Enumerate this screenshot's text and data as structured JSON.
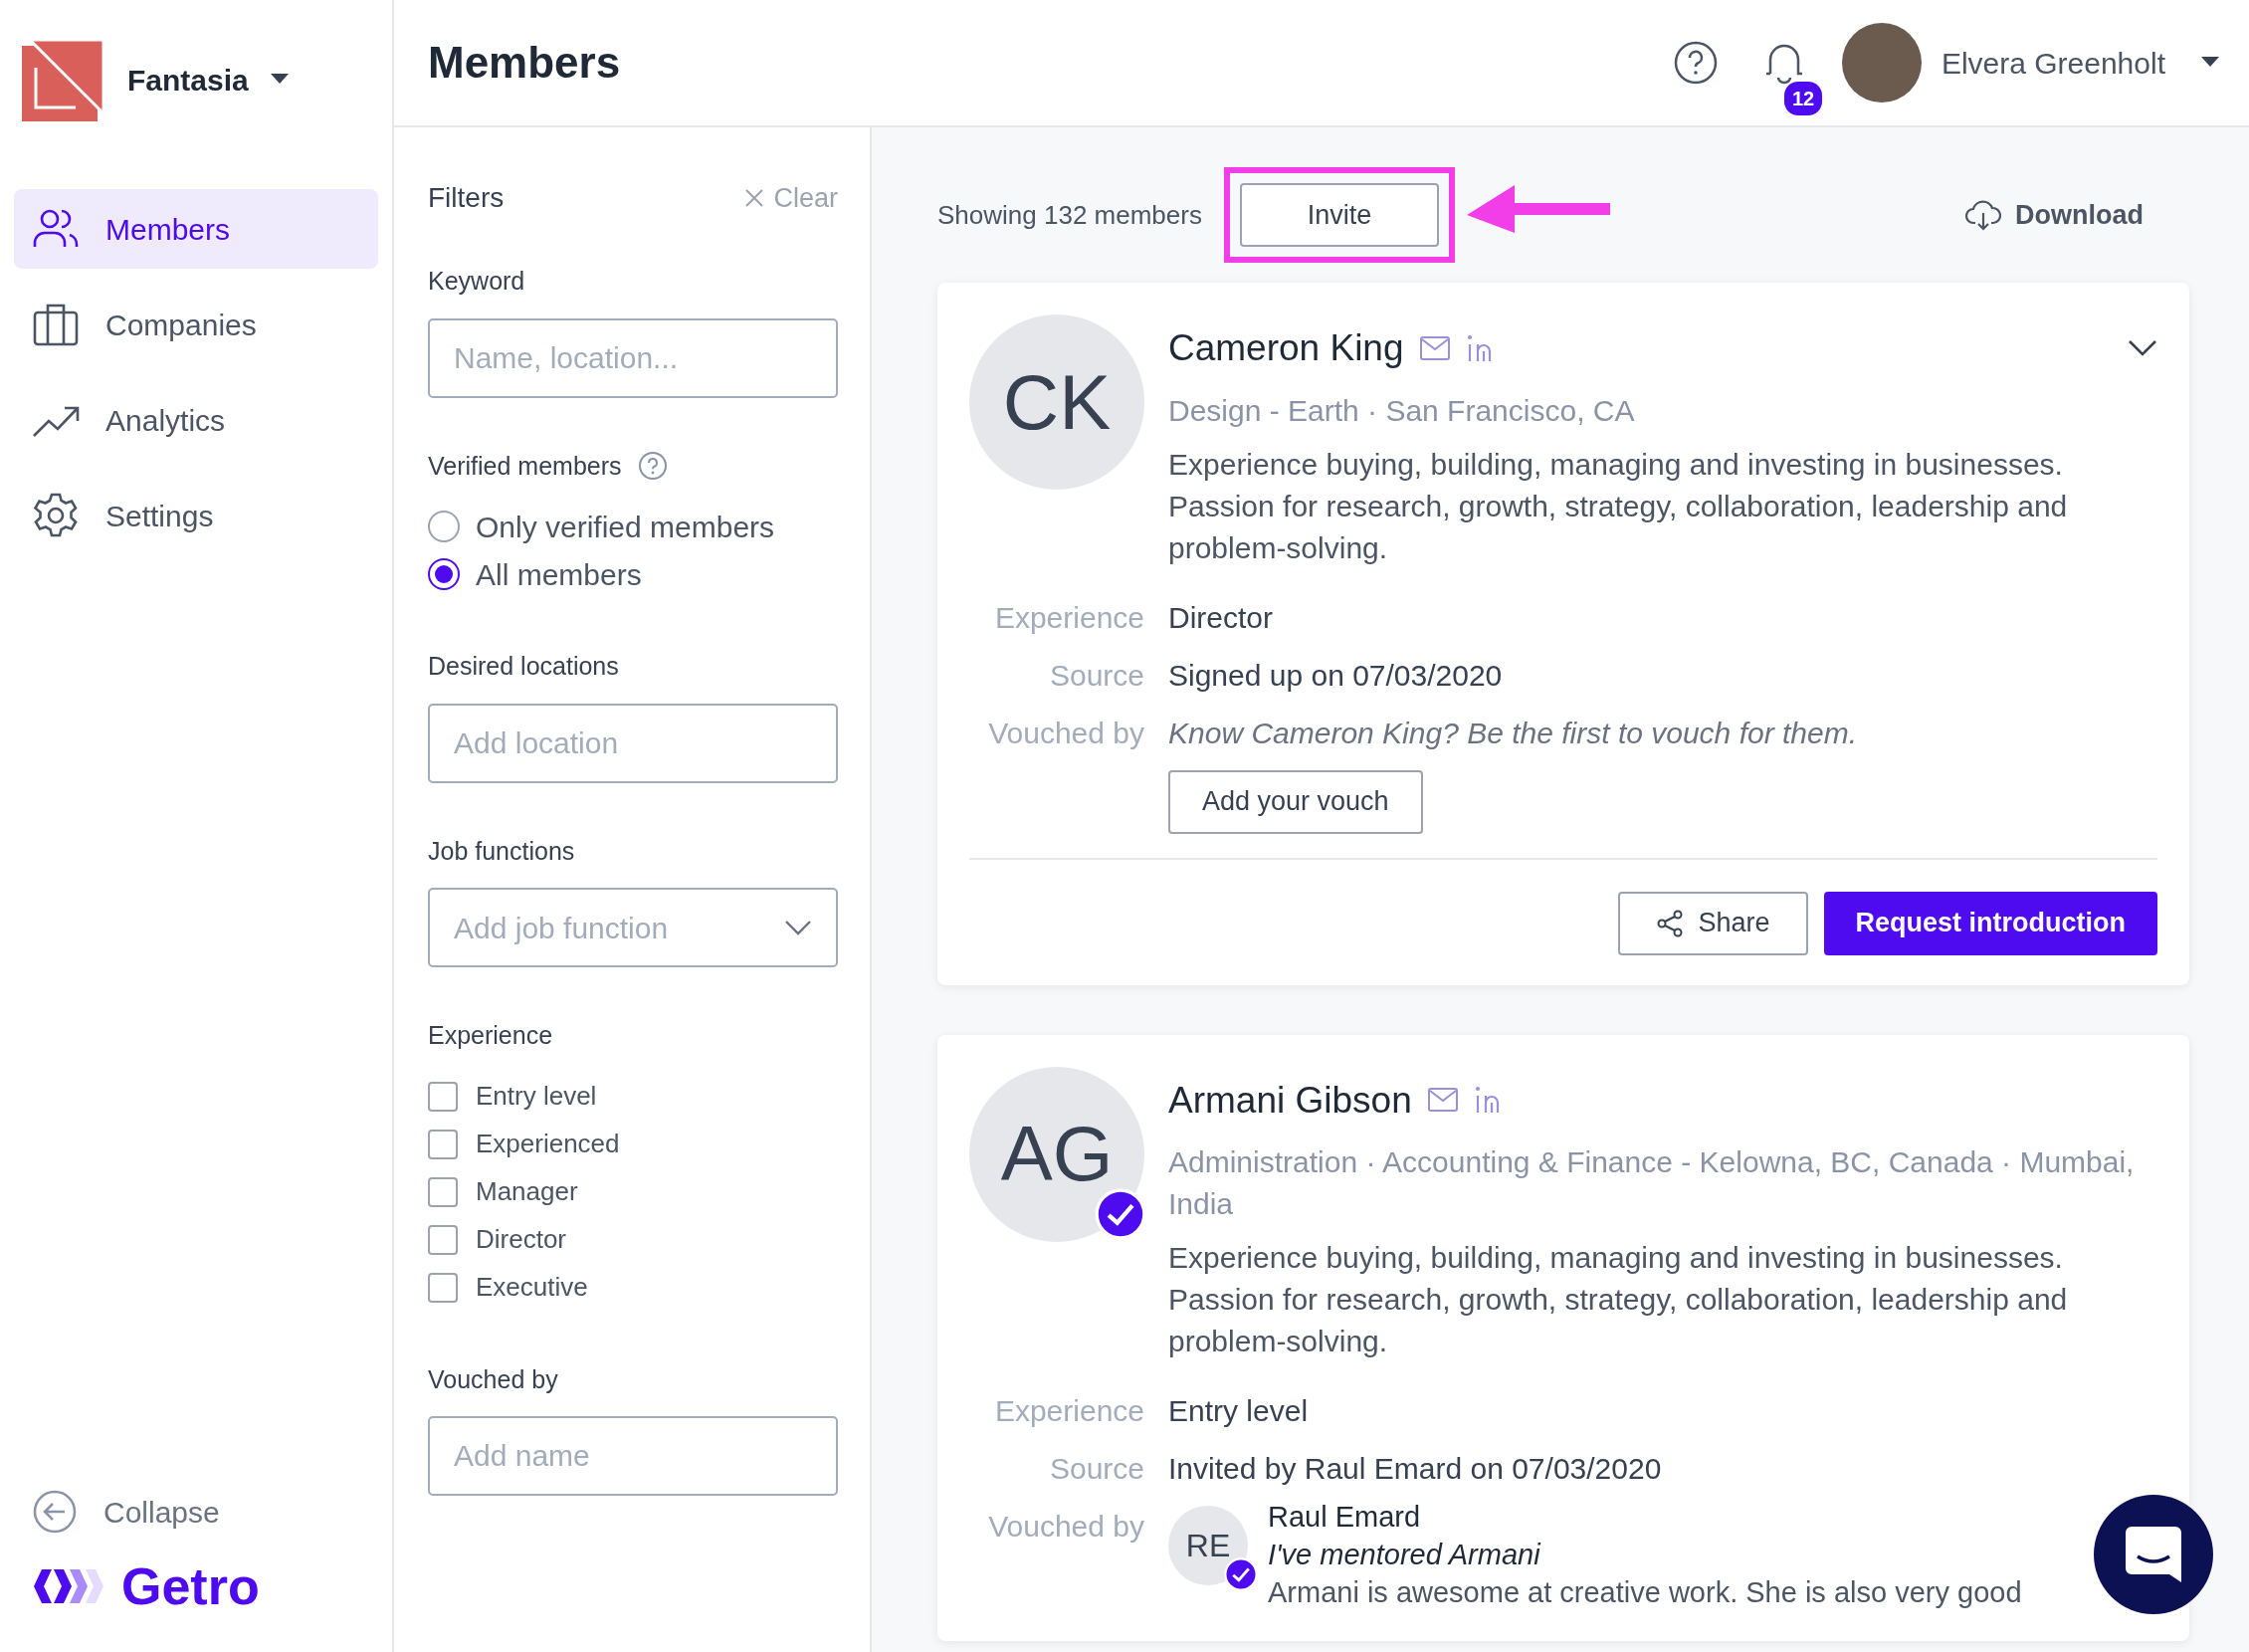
{
  "org": {
    "name": "Fantasia"
  },
  "nav": [
    {
      "label": "Members",
      "selected": true
    },
    {
      "label": "Companies",
      "selected": false
    },
    {
      "label": "Analytics",
      "selected": false
    },
    {
      "label": "Settings",
      "selected": false
    }
  ],
  "collapse": {
    "label": "Collapse"
  },
  "brand": {
    "name": "Getro"
  },
  "header": {
    "title": "Members",
    "notifications": "12",
    "user": "Elvera Greenholt"
  },
  "filters": {
    "title": "Filters",
    "clear": "Clear",
    "sections": [
      {
        "kind": "text",
        "label": "Keyword",
        "placeholder": "Name, location..."
      },
      {
        "kind": "radio",
        "label": "Verified members",
        "has_help": true,
        "options": [
          {
            "label": "Only verified members",
            "selected": false
          },
          {
            "label": "All members",
            "selected": true
          }
        ]
      },
      {
        "kind": "text",
        "label": "Desired locations",
        "placeholder": "Add location"
      },
      {
        "kind": "select",
        "label": "Job functions",
        "placeholder": "Add job function"
      },
      {
        "kind": "checkbox",
        "label": "Experience",
        "options": [
          {
            "label": "Entry level",
            "checked": false
          },
          {
            "label": "Experienced",
            "checked": false
          },
          {
            "label": "Manager",
            "checked": false
          },
          {
            "label": "Director",
            "checked": false
          },
          {
            "label": "Executive",
            "checked": false
          }
        ]
      },
      {
        "kind": "text",
        "label": "Vouched by",
        "placeholder": "Add name"
      }
    ]
  },
  "toolbar": {
    "count": "Showing 132 members",
    "invite": "Invite",
    "download": "Download"
  },
  "members": [
    {
      "initials": "CK",
      "name": "Cameron King",
      "verified": false,
      "collapsible": true,
      "meta": "Design - Earth · San Francisco, CA",
      "bio": "Experience buying, building, managing and investing in businesses. Passion for research, growth, strategy, collaboration, leadership and problem-solving.",
      "details": [
        {
          "label": "Experience",
          "value": "Director"
        },
        {
          "label": "Source",
          "value": "Signed up on 07/03/2020"
        }
      ],
      "vouched_label": "Vouched by",
      "vouch_prompt": "Know Cameron King? Be the first to vouch for them.",
      "vouch_button": "Add your vouch",
      "share": "Share",
      "request": "Request introduction"
    },
    {
      "initials": "AG",
      "name": "Armani Gibson",
      "verified": true,
      "collapsible": false,
      "meta": "Administration · Accounting & Finance - Kelowna, BC, Canada · Mumbai, India",
      "bio": "Experience buying, building, managing and investing in businesses. Passion for research, growth, strategy, collaboration, leadership and problem-solving.",
      "details": [
        {
          "label": "Experience",
          "value": "Entry level"
        },
        {
          "label": "Source",
          "value": "Invited by Raul Emard on 07/03/2020"
        }
      ],
      "vouched_label": "Vouched by",
      "vouches": [
        {
          "initials": "RE",
          "verified": true,
          "name": "Raul Emard",
          "title": "I've mentored Armani",
          "text": "Armani is awesome at creative work. She is also very good"
        }
      ]
    }
  ]
}
